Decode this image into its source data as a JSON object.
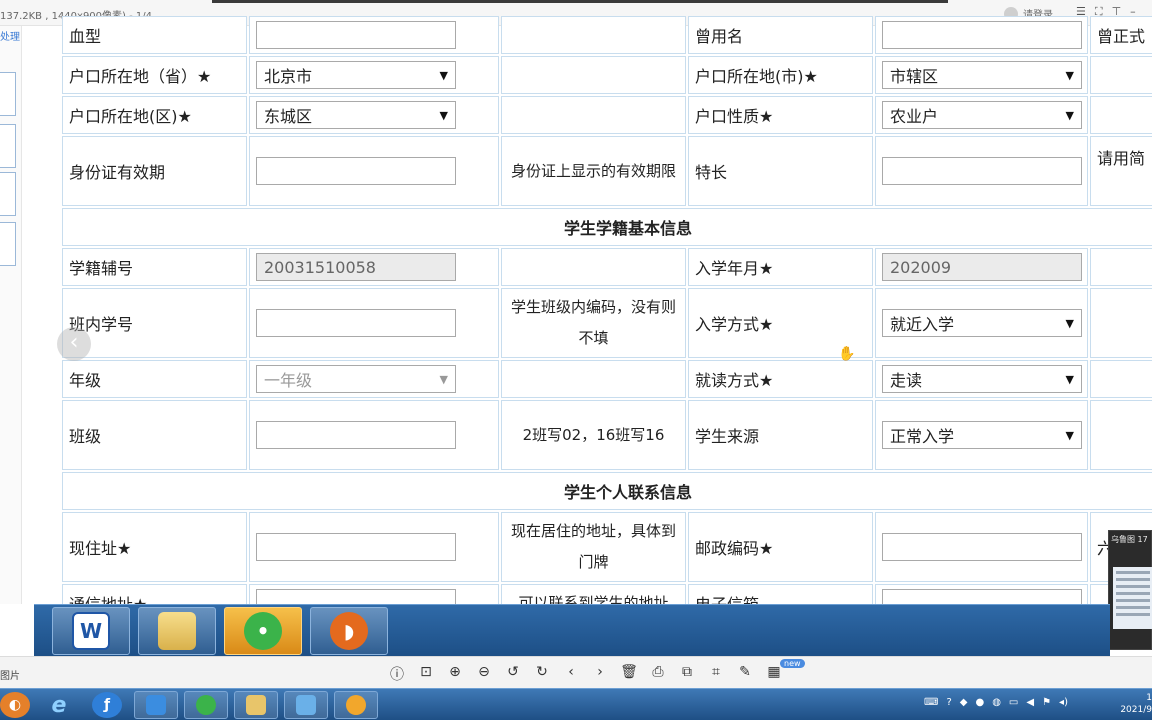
{
  "viewer": {
    "file_info": "137.2KB , 1440x900像素) - 1/4",
    "login_label": "请登录",
    "side_label": "处理",
    "bottom_left_label": "图片",
    "new_badge": "new",
    "thumbnail_title": "乌鲁图 17"
  },
  "form": {
    "rows": [
      {
        "type": "field",
        "label": "血型",
        "value": "",
        "note": "",
        "label2": "曾用名",
        "value2": "",
        "extra": "曾正式"
      },
      {
        "type": "field",
        "label": "户口所在地（省）★",
        "value": "北京市",
        "select": true,
        "note": "",
        "label2": "户口所在地(市)★",
        "value2": "市辖区",
        "select2": true,
        "extra": ""
      },
      {
        "type": "field",
        "label": "户口所在地(区)★",
        "value": "东城区",
        "select": true,
        "note": "",
        "label2": "户口性质★",
        "value2": "农业户",
        "select2": true,
        "extra": ""
      },
      {
        "type": "field",
        "label": "身份证有效期",
        "value": "",
        "note": "身份证上显示的有效期限",
        "label2": "特长",
        "value2": "",
        "extra": "请用简"
      },
      {
        "type": "section",
        "title": "学生学籍基本信息"
      },
      {
        "type": "field",
        "label": "学籍辅号",
        "value": "20031510058",
        "readonly": true,
        "note": "",
        "label2": "入学年月★",
        "value2": "202009",
        "readonly2": true,
        "extra": ""
      },
      {
        "type": "field",
        "label": "班内学号",
        "value": "",
        "note": "学生班级内编码，没有则不填",
        "label2": "入学方式★",
        "value2": "就近入学",
        "select2": true,
        "extra": ""
      },
      {
        "type": "field",
        "label": "年级",
        "value": "一年级",
        "select": true,
        "disabled": true,
        "note": "",
        "label2": "就读方式★",
        "value2": "走读",
        "select2": true,
        "extra": ""
      },
      {
        "type": "field",
        "label": "班级",
        "value": "",
        "note": "2班写02，16班写16",
        "label2": "学生来源",
        "value2": "正常入学",
        "select2": true,
        "extra": ""
      },
      {
        "type": "section",
        "title": "学生个人联系信息"
      },
      {
        "type": "field",
        "label": "现住址★",
        "value": "",
        "note": "现在居住的地址，具体到门牌",
        "label2": "邮政编码★",
        "value2": "",
        "extra": "六"
      },
      {
        "type": "field",
        "label": "通信地址★",
        "value": "",
        "note": "可以联系到学生的地址",
        "label2": "电子信箱",
        "value2": "",
        "extra": ""
      }
    ]
  },
  "taskbar_apps": [
    "word-icon",
    "folder-icon",
    "wechat-icon",
    "app-icon"
  ],
  "icons": {
    "select_arrow": "▼",
    "prev_arrow": "‹",
    "cursor": "hand-cursor-icon"
  }
}
